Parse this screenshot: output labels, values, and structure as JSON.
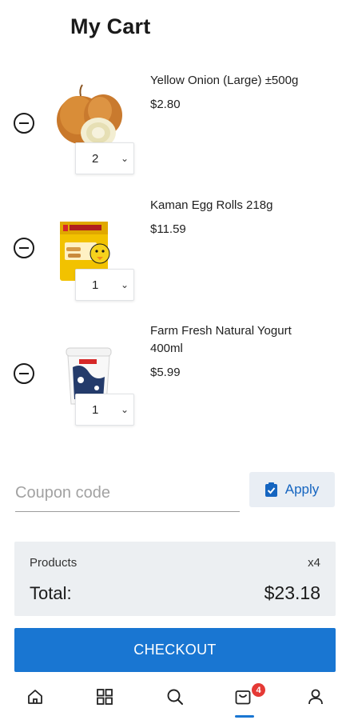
{
  "header": {
    "title": "My Cart"
  },
  "cart": {
    "items": [
      {
        "name": "Yellow Onion (Large) ±500g",
        "price": "$2.80",
        "quantity": "2",
        "image": "onion-image"
      },
      {
        "name": "Kaman Egg Rolls 218g",
        "price": "$11.59",
        "quantity": "1",
        "image": "egg-rolls-image"
      },
      {
        "name": "Farm Fresh Natural Yogurt 400ml",
        "price": "$5.99",
        "quantity": "1",
        "image": "yogurt-image"
      }
    ]
  },
  "coupon": {
    "placeholder": "Coupon code",
    "value": "",
    "apply_label": "Apply",
    "apply_icon": "clipboard-check-icon"
  },
  "summary": {
    "products_label": "Products",
    "products_count": "x4",
    "total_label": "Total:",
    "total_value": "$23.18"
  },
  "checkout": {
    "label": "CHECKOUT"
  },
  "nav": {
    "items": [
      {
        "icon": "home-icon"
      },
      {
        "icon": "grid-icon"
      },
      {
        "icon": "search-icon"
      },
      {
        "icon": "cart-icon",
        "badge": "4",
        "active": true
      },
      {
        "icon": "profile-icon"
      }
    ]
  },
  "colors": {
    "accent": "#1976d2",
    "badge": "#e53935",
    "summary_bg": "#eceff2",
    "apply_bg": "#e9eef4"
  }
}
